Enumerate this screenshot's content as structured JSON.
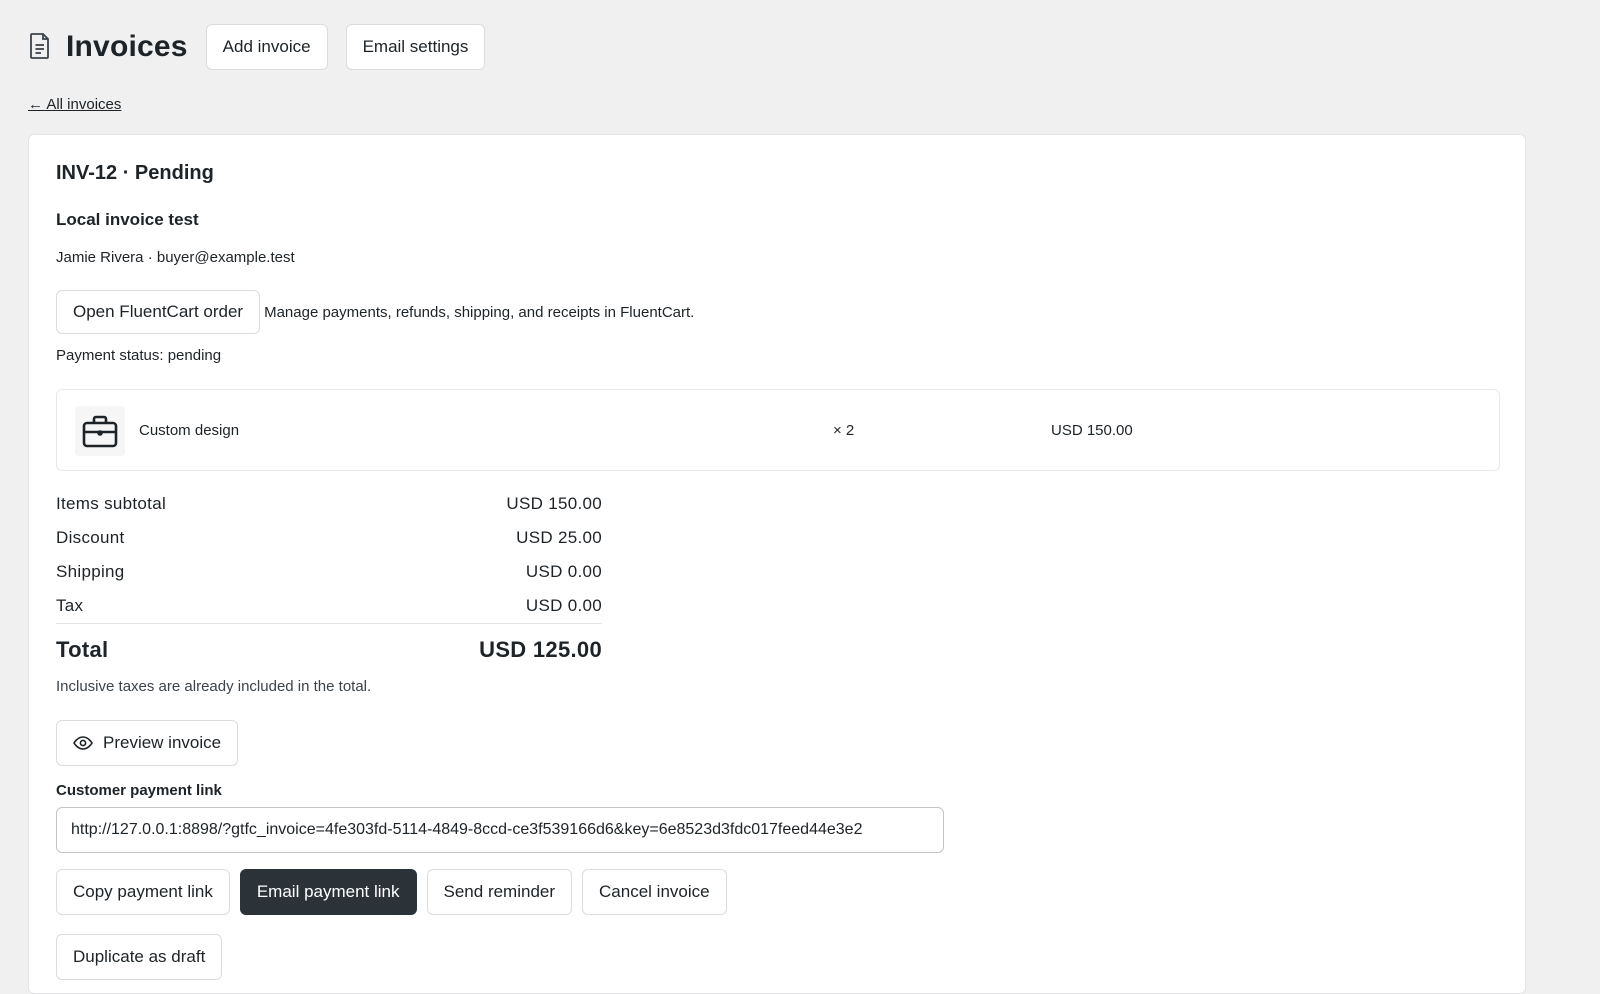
{
  "header": {
    "title": "Invoices",
    "add_invoice": "Add invoice",
    "email_settings": "Email settings"
  },
  "back_link": "← All invoices",
  "invoice": {
    "heading": "INV-12 · Pending",
    "title": "Local invoice test",
    "customer": "Jamie Rivera · buyer@example.test",
    "open_order_button": "Open FluentCart order",
    "open_order_note": "Manage payments, refunds, shipping, and receipts in FluentCart.",
    "payment_status": "Payment status: pending",
    "items": [
      {
        "name": "Custom design",
        "qty": "× 2",
        "price": "USD 150.00",
        "icon": "briefcase-icon"
      }
    ],
    "totals": [
      {
        "label": "Items subtotal",
        "value": "USD 150.00"
      },
      {
        "label": "Discount",
        "value": "USD 25.00"
      },
      {
        "label": "Shipping",
        "value": "USD 0.00"
      },
      {
        "label": "Tax",
        "value": "USD 0.00"
      }
    ],
    "total": {
      "label": "Total",
      "value": "USD 125.00"
    },
    "tax_note": "Inclusive taxes are already included in the total.",
    "preview_button": "Preview invoice",
    "payment_link_label": "Customer payment link",
    "payment_link_value": "http://127.0.0.1:8898/?gtfc_invoice=4fe303fd-5114-4849-8ccd-ce3f539166d6&key=6e8523d3fdc017feed44e3e2",
    "actions": {
      "copy": "Copy payment link",
      "email": "Email payment link",
      "reminder": "Send reminder",
      "cancel": "Cancel invoice",
      "duplicate": "Duplicate as draft"
    }
  },
  "colors": {
    "background": "#f0f0f1",
    "primary_button": "#2c3338",
    "text": "#1d2327"
  }
}
